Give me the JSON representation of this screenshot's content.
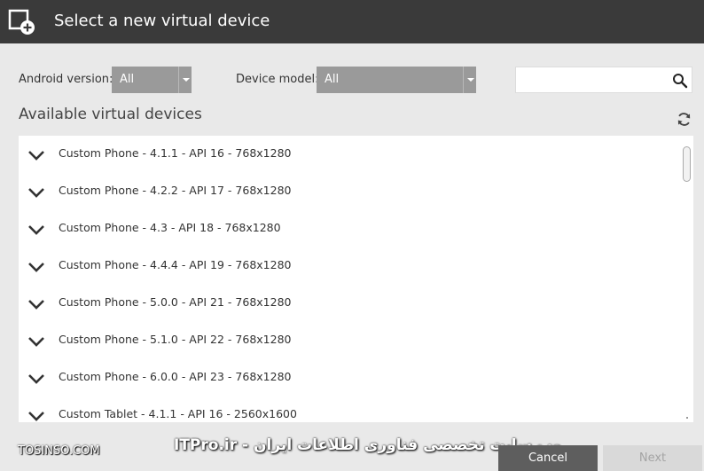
{
  "dialog": {
    "title": "Select a new virtual device",
    "icon": "add-device-icon"
  },
  "filters": {
    "android_version_label": "Android version:",
    "android_version_value": "All",
    "device_model_label": "Device model:",
    "device_model_value": "All",
    "search_placeholder": ""
  },
  "list": {
    "title": "Available virtual devices",
    "devices": [
      "Custom Phone - 4.1.1 - API 16 - 768x1280",
      "Custom Phone - 4.2.2 - API 17 - 768x1280",
      "Custom Phone - 4.3 - API 18 - 768x1280",
      "Custom Phone - 4.4.4 - API 19 - 768x1280",
      "Custom Phone - 5.0.0 - API 21 - 768x1280",
      "Custom Phone - 5.1.0 - API 22 - 768x1280",
      "Custom Phone - 6.0.0 - API 23 - 768x1280",
      "Custom Tablet - 4.1.1 - API 16 - 2560x1600"
    ]
  },
  "buttons": {
    "cancel": "Cancel",
    "next": "Next"
  },
  "watermark": {
    "left": "TOSINSO.COM",
    "right": "وب سایت تخصصی فناوری اطلاعات ایران - ITPro.ir"
  },
  "colors": {
    "titlebar": "#3a3a3a",
    "select_bg": "#9a9a9a",
    "cancel_bg": "#5e5e5e",
    "next_bg": "#d9d9d9"
  }
}
